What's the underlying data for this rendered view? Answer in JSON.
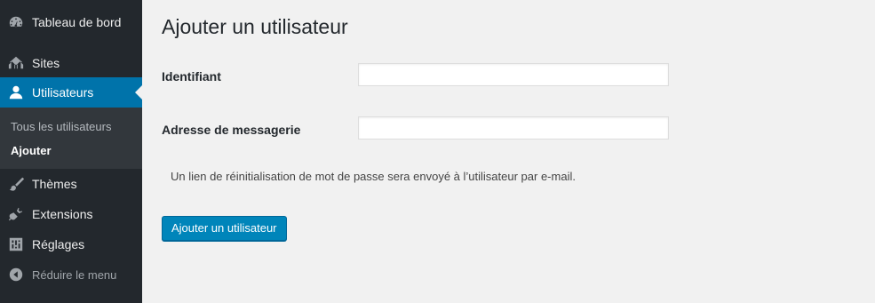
{
  "sidebar": {
    "items": [
      {
        "label": "Tableau de bord",
        "icon": "dashboard-icon"
      },
      {
        "label": "Sites",
        "icon": "sites-icon"
      },
      {
        "label": "Utilisateurs",
        "icon": "users-icon",
        "current": true
      },
      {
        "label": "Thèmes",
        "icon": "brush-icon"
      },
      {
        "label": "Extensions",
        "icon": "plugin-icon"
      },
      {
        "label": "Réglages",
        "icon": "settings-icon"
      }
    ],
    "submenu": [
      {
        "label": "Tous les utilisateurs"
      },
      {
        "label": "Ajouter",
        "active": true
      }
    ],
    "collapse_label": "Réduire le menu"
  },
  "page": {
    "title": "Ajouter un utilisateur",
    "fields": {
      "username_label": "Identifiant",
      "username_value": "",
      "email_label": "Adresse de messagerie",
      "email_value": ""
    },
    "note": "Un lien de réinitialisation de mot de passe sera envoyé à l’utilisateur par e-mail.",
    "submit_label": "Ajouter un utilisateur"
  },
  "colors": {
    "sidebar_bg": "#23282d",
    "submenu_bg": "#32373c",
    "accent": "#0073aa",
    "button": "#0085ba",
    "page_bg": "#f1f1f1"
  }
}
